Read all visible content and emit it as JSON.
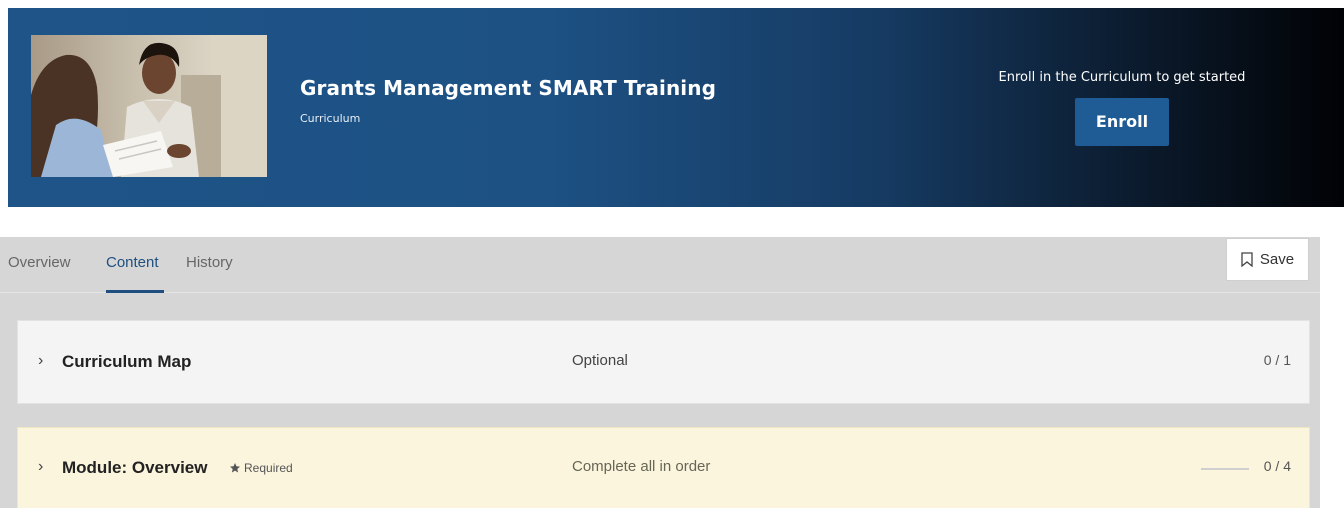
{
  "hero": {
    "title": "Grants Management SMART Training",
    "subtitle": "Curriculum",
    "enroll_prompt": "Enroll in the Curriculum to get started",
    "enroll_label": "Enroll",
    "image_icon": "business-meeting-photo"
  },
  "tabs": [
    {
      "label": "Overview",
      "active": false
    },
    {
      "label": "Content",
      "active": true
    },
    {
      "label": "History",
      "active": false
    }
  ],
  "save": {
    "label": "Save",
    "icon": "bookmark-icon"
  },
  "rows": [
    {
      "title": "Curriculum Map",
      "requirement": "Optional",
      "count": "0 / 1",
      "required": false,
      "progress": 0
    },
    {
      "title": "Module: Overview",
      "badge": "Required",
      "requirement": "Complete all in order",
      "count": "0 / 4",
      "required": true,
      "progress": 0
    }
  ],
  "colors": {
    "hero_start": "#1e5488",
    "hero_end": "#010204",
    "accent": "#1e4f80",
    "button": "#1f5c95",
    "required_row": "#fbf5de"
  }
}
